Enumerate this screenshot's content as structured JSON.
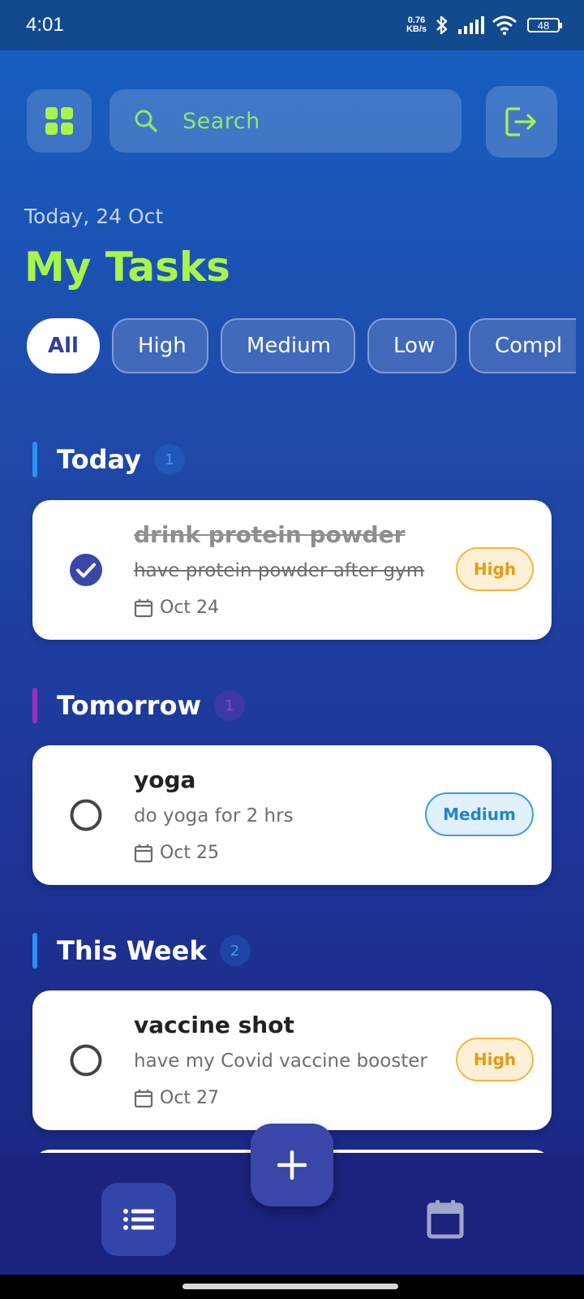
{
  "status_bar": {
    "time": "4:01",
    "net_speed_value": "0.76",
    "net_speed_unit": "KB/s",
    "battery": "48",
    "icons": [
      "bluetooth-icon",
      "signal-icon",
      "wifi-icon",
      "battery-icon"
    ]
  },
  "header": {
    "search_placeholder": "Search",
    "date_label": "Today, 24 Oct",
    "title": "My Tasks"
  },
  "filters": [
    "All",
    "High",
    "Medium",
    "Low",
    "Compl"
  ],
  "active_filter": "All",
  "sections": [
    {
      "title": "Today",
      "count": "1",
      "accent": "#2f8ff2"
    },
    {
      "title": "Tomorrow",
      "count": "1",
      "accent": "#9c2fc0"
    },
    {
      "title": "This Week",
      "count": "2",
      "accent": "#2f8ff2"
    }
  ],
  "tasks": [
    {
      "title": "drink protein powder",
      "description": "have protein powder after gym",
      "date": "Oct 24",
      "priority": "High",
      "completed": true
    },
    {
      "title": "yoga",
      "description": "do yoga for 2 hrs",
      "date": "Oct 25",
      "priority": "Medium",
      "completed": false
    },
    {
      "title": "vaccine shot",
      "description": "have my Covid vaccine booster",
      "date": "Oct 27",
      "priority": "High",
      "completed": false
    }
  ],
  "colors": {
    "accent_green": "#a6f54e",
    "high": "#e79b12",
    "medium": "#2184cf",
    "check": "#3a46a8"
  },
  "bottom_nav": [
    "list-icon",
    "calendar-icon"
  ],
  "fab_icon": "plus-icon"
}
